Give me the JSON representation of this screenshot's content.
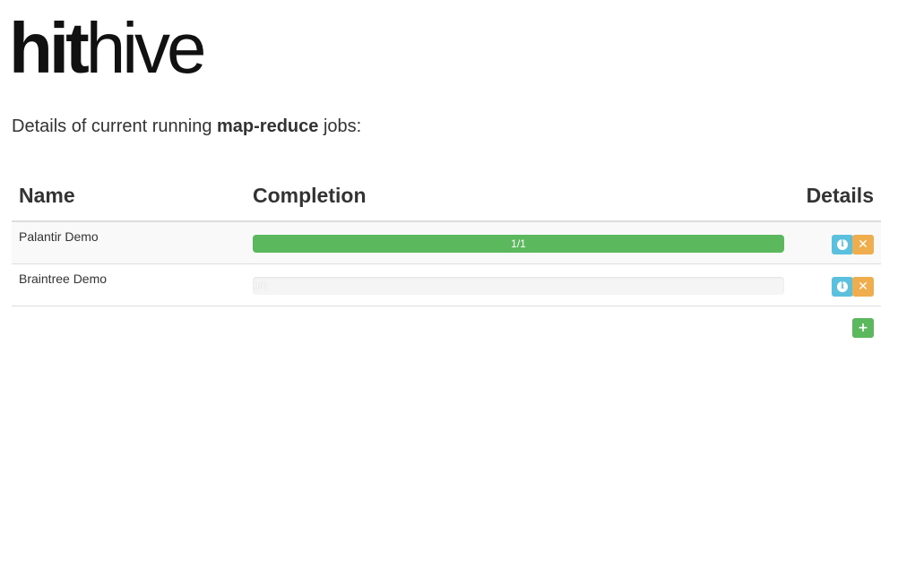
{
  "logo": {
    "bold_part": "hit",
    "light_part": "hive"
  },
  "intro": {
    "prefix": "Details of current running ",
    "highlight": "map-reduce",
    "suffix": " jobs:"
  },
  "table": {
    "columns": [
      "Name",
      "Completion",
      "Details"
    ],
    "rows": [
      {
        "name": "Palantir Demo",
        "progress_label": "1/1",
        "progress_fraction": 1.0
      },
      {
        "name": "Braintree Demo",
        "progress_label": "0/6",
        "progress_fraction": 0.0
      }
    ]
  },
  "icons": {
    "info": "info-icon",
    "remove": "remove-icon",
    "add": "add-icon",
    "info_glyph": "i",
    "remove_glyph": "✕",
    "add_glyph": "+"
  },
  "colors": {
    "success": "#5cb85c",
    "info": "#5bc0de",
    "warning": "#f0ad4e"
  }
}
